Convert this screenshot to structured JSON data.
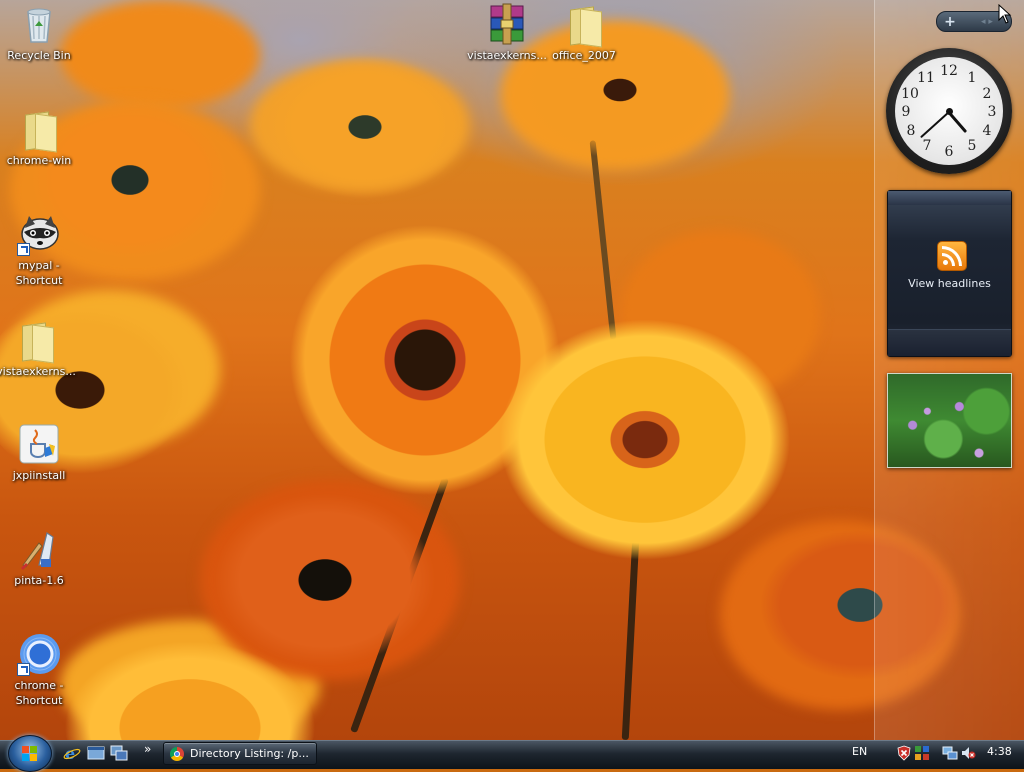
{
  "desktop": {
    "icons": [
      {
        "id": "recycle-bin",
        "label": "Recycle Bin"
      },
      {
        "id": "chrome-win",
        "label": "chrome-win"
      },
      {
        "id": "mypal-shortcut",
        "label": "mypal - Shortcut"
      },
      {
        "id": "vistaexkerns-left",
        "label": "vistaexkerns..."
      },
      {
        "id": "jxpiinstall",
        "label": "jxpiinstall"
      },
      {
        "id": "pinta",
        "label": "pinta-1.6"
      },
      {
        "id": "chrome-shortcut",
        "label": "chrome - Shortcut"
      },
      {
        "id": "vistaexkerns-top",
        "label": "vistaexkerns..."
      },
      {
        "id": "office-2007",
        "label": "office_2007"
      }
    ]
  },
  "sidebar": {
    "add_gadget_symbol": "+",
    "nav_symbol": "◂ ▸",
    "clock": {
      "numbers": [
        "12",
        "1",
        "2",
        "3",
        "4",
        "5",
        "6",
        "7",
        "8",
        "9",
        "10",
        "11"
      ],
      "hour": 4,
      "minute": 38
    },
    "feed": {
      "label": "View headlines"
    }
  },
  "taskbar": {
    "quick_launch_more": "»",
    "tasks": [
      {
        "label": "Directory Listing: /p..."
      }
    ],
    "tray": {
      "language": "EN",
      "time": "4:38"
    }
  },
  "colors": {
    "taskbar_top": "#4a5663",
    "taskbar_bottom": "#0d1319",
    "accent_orange": "#e8780a",
    "wallpaper_base": "#d9801f"
  }
}
